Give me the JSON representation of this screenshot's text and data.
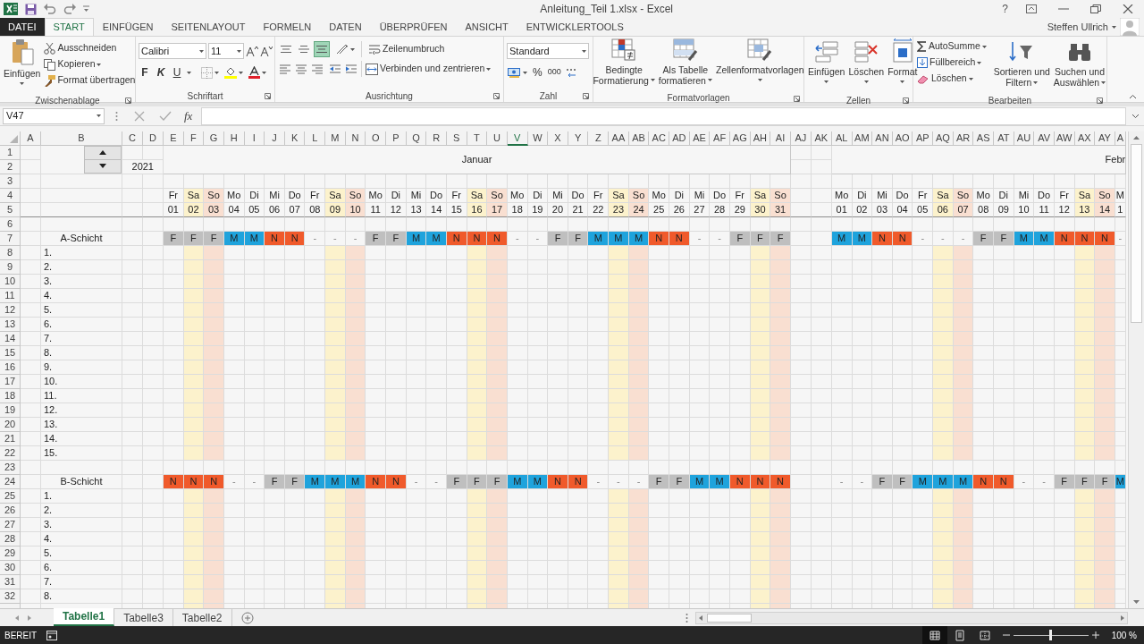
{
  "title_bar": {
    "title": "Anleitung_Teil 1.xlsx - Excel",
    "help": "?"
  },
  "ribbon_tabs": [
    {
      "label": "DATEI",
      "kind": "file",
      "selected": false
    },
    {
      "label": "START",
      "kind": "tab",
      "selected": true
    },
    {
      "label": "EINFÜGEN",
      "kind": "tab",
      "selected": false
    },
    {
      "label": "SEITENLAYOUT",
      "kind": "tab",
      "selected": false
    },
    {
      "label": "FORMELN",
      "kind": "tab",
      "selected": false
    },
    {
      "label": "DATEN",
      "kind": "tab",
      "selected": false
    },
    {
      "label": "ÜBERPRÜFEN",
      "kind": "tab",
      "selected": false
    },
    {
      "label": "ANSICHT",
      "kind": "tab",
      "selected": false
    },
    {
      "label": "ENTWICKLERTOOLS",
      "kind": "tab",
      "selected": false
    }
  ],
  "user": "Steffen Ullrich",
  "ribbon": {
    "clipboard": {
      "label": "Zwischenablage",
      "paste": "Einfügen",
      "cut": "Ausschneiden",
      "copy": "Kopieren",
      "format_painter": "Format übertragen"
    },
    "font": {
      "label": "Schriftart",
      "font_name": "Calibri",
      "font_size": "11",
      "bold": "F",
      "italic": "K",
      "underline": "U"
    },
    "alignment": {
      "label": "Ausrichtung",
      "wrap": "Zeilenumbruch",
      "merge": "Verbinden und zentrieren",
      "vertical_align": [
        {
          "selected": false
        },
        {
          "selected": false
        },
        {
          "selected": true
        }
      ]
    },
    "number": {
      "label": "Zahl",
      "format": "Standard",
      "percent": "%",
      "thousands": "000"
    },
    "styles": {
      "label": "Formatvorlagen",
      "conditional": [
        "Bedingte",
        "Formatierung"
      ],
      "as_table": [
        "Als Tabelle",
        "formatieren"
      ],
      "cell_styles": [
        "Zellenformatvorlagen"
      ]
    },
    "cells": {
      "label": "Zellen",
      "insert": "Einfügen",
      "delete": "Löschen",
      "format": "Format"
    },
    "editing": {
      "label": "Bearbeiten",
      "autosum": "AutoSumme",
      "fill": "Füllbereich",
      "clear": "Löschen",
      "sort": [
        "Sortieren und",
        "Filtern"
      ],
      "find": [
        "Suchen und",
        "Auswählen"
      ]
    }
  },
  "formula_bar": {
    "name_box": "V47",
    "function_symbol": "fx"
  },
  "sheet": {
    "columns": [
      {
        "label": "A",
        "selected": false
      },
      {
        "label": "B",
        "selected": false
      },
      {
        "label": "C",
        "selected": false
      },
      {
        "label": "D",
        "selected": false
      },
      {
        "label": "E",
        "selected": false
      },
      {
        "label": "F",
        "selected": false
      },
      {
        "label": "G",
        "selected": false
      },
      {
        "label": "H",
        "selected": false
      },
      {
        "label": "I",
        "selected": false
      },
      {
        "label": "J",
        "selected": false
      },
      {
        "label": "K",
        "selected": false
      },
      {
        "label": "L",
        "selected": false
      },
      {
        "label": "M",
        "selected": false
      },
      {
        "label": "N",
        "selected": false
      },
      {
        "label": "O",
        "selected": false
      },
      {
        "label": "P",
        "selected": false
      },
      {
        "label": "Q",
        "selected": false
      },
      {
        "label": "R",
        "selected": false
      },
      {
        "label": "S",
        "selected": false
      },
      {
        "label": "T",
        "selected": false
      },
      {
        "label": "U",
        "selected": false
      },
      {
        "label": "V",
        "selected": true
      },
      {
        "label": "W",
        "selected": false
      },
      {
        "label": "X",
        "selected": false
      },
      {
        "label": "Y",
        "selected": false
      },
      {
        "label": "Z",
        "selected": false
      },
      {
        "label": "AA",
        "selected": false
      },
      {
        "label": "AB",
        "selected": false
      },
      {
        "label": "AC",
        "selected": false
      },
      {
        "label": "AD",
        "selected": false
      },
      {
        "label": "AE",
        "selected": false
      },
      {
        "label": "AF",
        "selected": false
      },
      {
        "label": "AG",
        "selected": false
      },
      {
        "label": "AH",
        "selected": false
      },
      {
        "label": "AI",
        "selected": false
      },
      {
        "label": "AJ",
        "selected": false
      },
      {
        "label": "AK",
        "selected": false
      },
      {
        "label": "AL",
        "selected": false
      },
      {
        "label": "AM",
        "selected": false
      },
      {
        "label": "AN",
        "selected": false
      },
      {
        "label": "AO",
        "selected": false
      },
      {
        "label": "AP",
        "selected": false
      },
      {
        "label": "AQ",
        "selected": false
      },
      {
        "label": "AR",
        "selected": false
      },
      {
        "label": "AS",
        "selected": false
      },
      {
        "label": "AT",
        "selected": false
      },
      {
        "label": "AU",
        "selected": false
      },
      {
        "label": "AV",
        "selected": false
      },
      {
        "label": "AW",
        "selected": false
      },
      {
        "label": "AX",
        "selected": false
      },
      {
        "label": "AY",
        "selected": false
      },
      {
        "label": "A",
        "selected": false
      }
    ],
    "rows": [
      "1",
      "2",
      "3",
      "4",
      "5",
      "6",
      "7",
      "8",
      "9",
      "10",
      "11",
      "12",
      "13",
      "14",
      "15",
      "16",
      "17",
      "18",
      "19",
      "20",
      "21",
      "22",
      "23",
      "24",
      "25",
      "26",
      "27",
      "28",
      "29",
      "30",
      "31",
      "32"
    ],
    "year": "2021",
    "months": [
      {
        "label": "Januar",
        "days": [
          {
            "weekday": "Fr",
            "day": "01",
            "kind": "weekday"
          },
          {
            "weekday": "Sa",
            "day": "02",
            "kind": "saturday"
          },
          {
            "weekday": "So",
            "day": "03",
            "kind": "sunday"
          },
          {
            "weekday": "Mo",
            "day": "04",
            "kind": "weekday"
          },
          {
            "weekday": "Di",
            "day": "05",
            "kind": "weekday"
          },
          {
            "weekday": "Mi",
            "day": "06",
            "kind": "weekday"
          },
          {
            "weekday": "Do",
            "day": "07",
            "kind": "weekday"
          },
          {
            "weekday": "Fr",
            "day": "08",
            "kind": "weekday"
          },
          {
            "weekday": "Sa",
            "day": "09",
            "kind": "saturday"
          },
          {
            "weekday": "So",
            "day": "10",
            "kind": "sunday"
          },
          {
            "weekday": "Mo",
            "day": "11",
            "kind": "weekday"
          },
          {
            "weekday": "Di",
            "day": "12",
            "kind": "weekday"
          },
          {
            "weekday": "Mi",
            "day": "13",
            "kind": "weekday"
          },
          {
            "weekday": "Do",
            "day": "14",
            "kind": "weekday"
          },
          {
            "weekday": "Fr",
            "day": "15",
            "kind": "weekday"
          },
          {
            "weekday": "Sa",
            "day": "16",
            "kind": "saturday"
          },
          {
            "weekday": "So",
            "day": "17",
            "kind": "sunday"
          },
          {
            "weekday": "Mo",
            "day": "18",
            "kind": "weekday"
          },
          {
            "weekday": "Di",
            "day": "19",
            "kind": "weekday"
          },
          {
            "weekday": "Mi",
            "day": "20",
            "kind": "weekday"
          },
          {
            "weekday": "Do",
            "day": "21",
            "kind": "weekday"
          },
          {
            "weekday": "Fr",
            "day": "22",
            "kind": "weekday"
          },
          {
            "weekday": "Sa",
            "day": "23",
            "kind": "saturday"
          },
          {
            "weekday": "So",
            "day": "24",
            "kind": "sunday"
          },
          {
            "weekday": "Mo",
            "day": "25",
            "kind": "weekday"
          },
          {
            "weekday": "Di",
            "day": "26",
            "kind": "weekday"
          },
          {
            "weekday": "Mi",
            "day": "27",
            "kind": "weekday"
          },
          {
            "weekday": "Do",
            "day": "28",
            "kind": "weekday"
          },
          {
            "weekday": "Fr",
            "day": "29",
            "kind": "weekday"
          },
          {
            "weekday": "Sa",
            "day": "30",
            "kind": "saturday"
          },
          {
            "weekday": "So",
            "day": "31",
            "kind": "sunday"
          }
        ]
      },
      {
        "label": "Febr",
        "days": [
          {
            "weekday": "Mo",
            "day": "01",
            "kind": "weekday"
          },
          {
            "weekday": "Di",
            "day": "02",
            "kind": "weekday"
          },
          {
            "weekday": "Mi",
            "day": "03",
            "kind": "weekday"
          },
          {
            "weekday": "Do",
            "day": "04",
            "kind": "weekday"
          },
          {
            "weekday": "Fr",
            "day": "05",
            "kind": "weekday"
          },
          {
            "weekday": "Sa",
            "day": "06",
            "kind": "saturday"
          },
          {
            "weekday": "So",
            "day": "07",
            "kind": "sunday"
          },
          {
            "weekday": "Mo",
            "day": "08",
            "kind": "weekday"
          },
          {
            "weekday": "Di",
            "day": "09",
            "kind": "weekday"
          },
          {
            "weekday": "Mi",
            "day": "10",
            "kind": "weekday"
          },
          {
            "weekday": "Do",
            "day": "11",
            "kind": "weekday"
          },
          {
            "weekday": "Fr",
            "day": "12",
            "kind": "weekday"
          },
          {
            "weekday": "Sa",
            "day": "13",
            "kind": "saturday"
          },
          {
            "weekday": "So",
            "day": "14",
            "kind": "sunday"
          },
          {
            "weekday": "M",
            "day": "1",
            "kind": "weekday"
          }
        ]
      }
    ],
    "shifts": [
      {
        "label": "A-Schicht",
        "months": [
          [
            {
              "code": "F",
              "color": "#bfbfbf"
            },
            {
              "code": "F",
              "color": "#bfbfbf"
            },
            {
              "code": "F",
              "color": "#bfbfbf"
            },
            {
              "code": "M",
              "color": "#1fa3dc"
            },
            {
              "code": "M",
              "color": "#1fa3dc"
            },
            {
              "code": "N",
              "color": "#f05a2b"
            },
            {
              "code": "N",
              "color": "#f05a2b"
            },
            {
              "code": "-"
            },
            {
              "code": "-"
            },
            {
              "code": "-"
            },
            {
              "code": "F",
              "color": "#bfbfbf"
            },
            {
              "code": "F",
              "color": "#bfbfbf"
            },
            {
              "code": "M",
              "color": "#1fa3dc"
            },
            {
              "code": "M",
              "color": "#1fa3dc"
            },
            {
              "code": "N",
              "color": "#f05a2b"
            },
            {
              "code": "N",
              "color": "#f05a2b"
            },
            {
              "code": "N",
              "color": "#f05a2b"
            },
            {
              "code": "-"
            },
            {
              "code": "-"
            },
            {
              "code": "F",
              "color": "#bfbfbf"
            },
            {
              "code": "F",
              "color": "#bfbfbf"
            },
            {
              "code": "M",
              "color": "#1fa3dc"
            },
            {
              "code": "M",
              "color": "#1fa3dc"
            },
            {
              "code": "M",
              "color": "#1fa3dc"
            },
            {
              "code": "N",
              "color": "#f05a2b"
            },
            {
              "code": "N",
              "color": "#f05a2b"
            },
            {
              "code": "-"
            },
            {
              "code": "-"
            },
            {
              "code": "F",
              "color": "#bfbfbf"
            },
            {
              "code": "F",
              "color": "#bfbfbf"
            },
            {
              "code": "F",
              "color": "#bfbfbf"
            }
          ],
          [
            {
              "code": "M",
              "color": "#1fa3dc"
            },
            {
              "code": "M",
              "color": "#1fa3dc"
            },
            {
              "code": "N",
              "color": "#f05a2b"
            },
            {
              "code": "N",
              "color": "#f05a2b"
            },
            {
              "code": "-"
            },
            {
              "code": "-"
            },
            {
              "code": "-"
            },
            {
              "code": "F",
              "color": "#bfbfbf"
            },
            {
              "code": "F",
              "color": "#bfbfbf"
            },
            {
              "code": "M",
              "color": "#1fa3dc"
            },
            {
              "code": "M",
              "color": "#1fa3dc"
            },
            {
              "code": "N",
              "color": "#f05a2b"
            },
            {
              "code": "N",
              "color": "#f05a2b"
            },
            {
              "code": "N",
              "color": "#f05a2b"
            },
            {
              "code": "-"
            }
          ]
        ],
        "members": [
          "1.",
          "2.",
          "3.",
          "4.",
          "5.",
          "6.",
          "7.",
          "8.",
          "9.",
          "10.",
          "11.",
          "12.",
          "13.",
          "14.",
          "15."
        ]
      },
      {
        "label": "B-Schicht",
        "months": [
          [
            {
              "code": "N",
              "color": "#f05a2b"
            },
            {
              "code": "N",
              "color": "#f05a2b"
            },
            {
              "code": "N",
              "color": "#f05a2b"
            },
            {
              "code": "-"
            },
            {
              "code": "-"
            },
            {
              "code": "F",
              "color": "#bfbfbf"
            },
            {
              "code": "F",
              "color": "#bfbfbf"
            },
            {
              "code": "M",
              "color": "#1fa3dc"
            },
            {
              "code": "M",
              "color": "#1fa3dc"
            },
            {
              "code": "M",
              "color": "#1fa3dc"
            },
            {
              "code": "N",
              "color": "#f05a2b"
            },
            {
              "code": "N",
              "color": "#f05a2b"
            },
            {
              "code": "-"
            },
            {
              "code": "-"
            },
            {
              "code": "F",
              "color": "#bfbfbf"
            },
            {
              "code": "F",
              "color": "#bfbfbf"
            },
            {
              "code": "F",
              "color": "#bfbfbf"
            },
            {
              "code": "M",
              "color": "#1fa3dc"
            },
            {
              "code": "M",
              "color": "#1fa3dc"
            },
            {
              "code": "N",
              "color": "#f05a2b"
            },
            {
              "code": "N",
              "color": "#f05a2b"
            },
            {
              "code": "-"
            },
            {
              "code": "-"
            },
            {
              "code": "-"
            },
            {
              "code": "F",
              "color": "#bfbfbf"
            },
            {
              "code": "F",
              "color": "#bfbfbf"
            },
            {
              "code": "M",
              "color": "#1fa3dc"
            },
            {
              "code": "M",
              "color": "#1fa3dc"
            },
            {
              "code": "N",
              "color": "#f05a2b"
            },
            {
              "code": "N",
              "color": "#f05a2b"
            },
            {
              "code": "N",
              "color": "#f05a2b"
            }
          ],
          [
            {
              "code": "-"
            },
            {
              "code": "-"
            },
            {
              "code": "F",
              "color": "#bfbfbf"
            },
            {
              "code": "F",
              "color": "#bfbfbf"
            },
            {
              "code": "M",
              "color": "#1fa3dc"
            },
            {
              "code": "M",
              "color": "#1fa3dc"
            },
            {
              "code": "M",
              "color": "#1fa3dc"
            },
            {
              "code": "N",
              "color": "#f05a2b"
            },
            {
              "code": "N",
              "color": "#f05a2b"
            },
            {
              "code": "-"
            },
            {
              "code": "-"
            },
            {
              "code": "F",
              "color": "#bfbfbf"
            },
            {
              "code": "F",
              "color": "#bfbfbf"
            },
            {
              "code": "F",
              "color": "#bfbfbf"
            },
            {
              "code": "M",
              "color": "#1fa3dc"
            }
          ]
        ],
        "members": [
          "1.",
          "2.",
          "3.",
          "4.",
          "5.",
          "6.",
          "7.",
          "8."
        ]
      }
    ]
  },
  "sheet_tabs": [
    {
      "label": "Tabelle1",
      "selected": true
    },
    {
      "label": "Tabelle3",
      "selected": false
    },
    {
      "label": "Tabelle2",
      "selected": false
    }
  ],
  "status_bar": {
    "status": "BEREIT",
    "views": [
      {
        "selected": true
      },
      {
        "selected": false
      },
      {
        "selected": false
      }
    ],
    "zoom": {
      "level": 0.5,
      "reading": "100 %"
    }
  }
}
